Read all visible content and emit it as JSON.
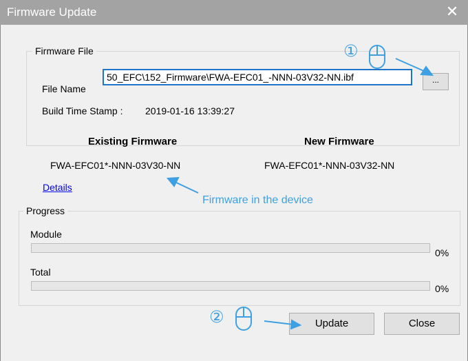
{
  "window": {
    "title": "Firmware Update",
    "close_glyph": "✕"
  },
  "firmware_file": {
    "legend": "Firmware File",
    "file_name_label": "File Name",
    "file_path": "50_EFC\\152_Firmware\\FWA-EFC01_-NNN-03V32-NN.ibf",
    "browse_label": "...",
    "build_time_label": "Build Time Stamp :",
    "build_time_value": "2019-01-16 13:39:27"
  },
  "firmware": {
    "existing_header": "Existing Firmware",
    "existing_value": "FWA-EFC01*-NNN-03V30-NN",
    "new_header": "New Firmware",
    "new_value": "FWA-EFC01*-NNN-03V32-NN",
    "details_link": "Details"
  },
  "progress": {
    "legend": "Progress",
    "module_label": "Module",
    "module_percent": "0%",
    "module_value": 0,
    "total_label": "Total",
    "total_percent": "0%",
    "total_value": 0
  },
  "buttons": {
    "update": "Update",
    "close": "Close"
  },
  "annotations": {
    "marker1": "①",
    "marker2": "②",
    "device_note": "Firmware in the device",
    "accent_color": "#3ea0e2",
    "icons": [
      "mouse-icon",
      "arrow-icon"
    ]
  }
}
